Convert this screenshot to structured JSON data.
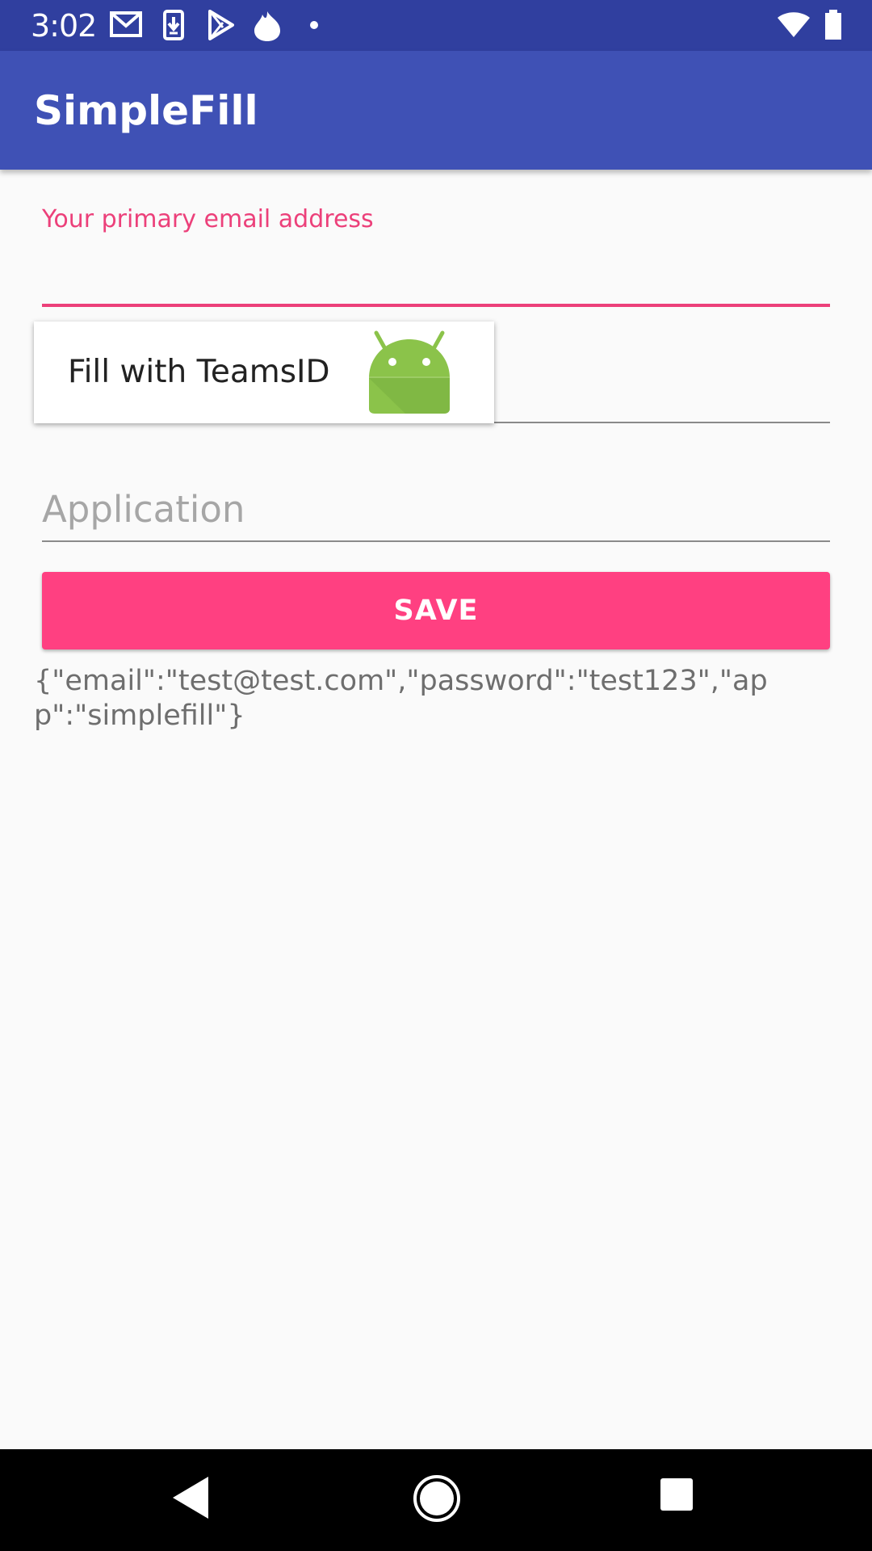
{
  "status_bar": {
    "time": "3:02",
    "icons": [
      "gmail-icon",
      "download-icon",
      "play-store-icon",
      "fire-icon",
      "dot-icon",
      "wifi-icon",
      "battery-icon"
    ]
  },
  "app_bar": {
    "title": "SimpleFill"
  },
  "form": {
    "email_label": "Your primary email address",
    "email_value": "",
    "password_value": "",
    "application_placeholder": "Application",
    "save_label": "SAVE"
  },
  "autofill": {
    "label": "Fill with TeamsID",
    "icon": "android-icon"
  },
  "output": {
    "json_text": "{\"email\":\"test@test.com\",\"password\":\"test123\",\"app\":\"simplefill\"}"
  },
  "nav_bar": {
    "buttons": [
      "back-icon",
      "home-icon",
      "recents-icon"
    ]
  },
  "colors": {
    "primary_dark": "#303f9f",
    "primary": "#3f51b5",
    "accent": "#ff4081"
  }
}
